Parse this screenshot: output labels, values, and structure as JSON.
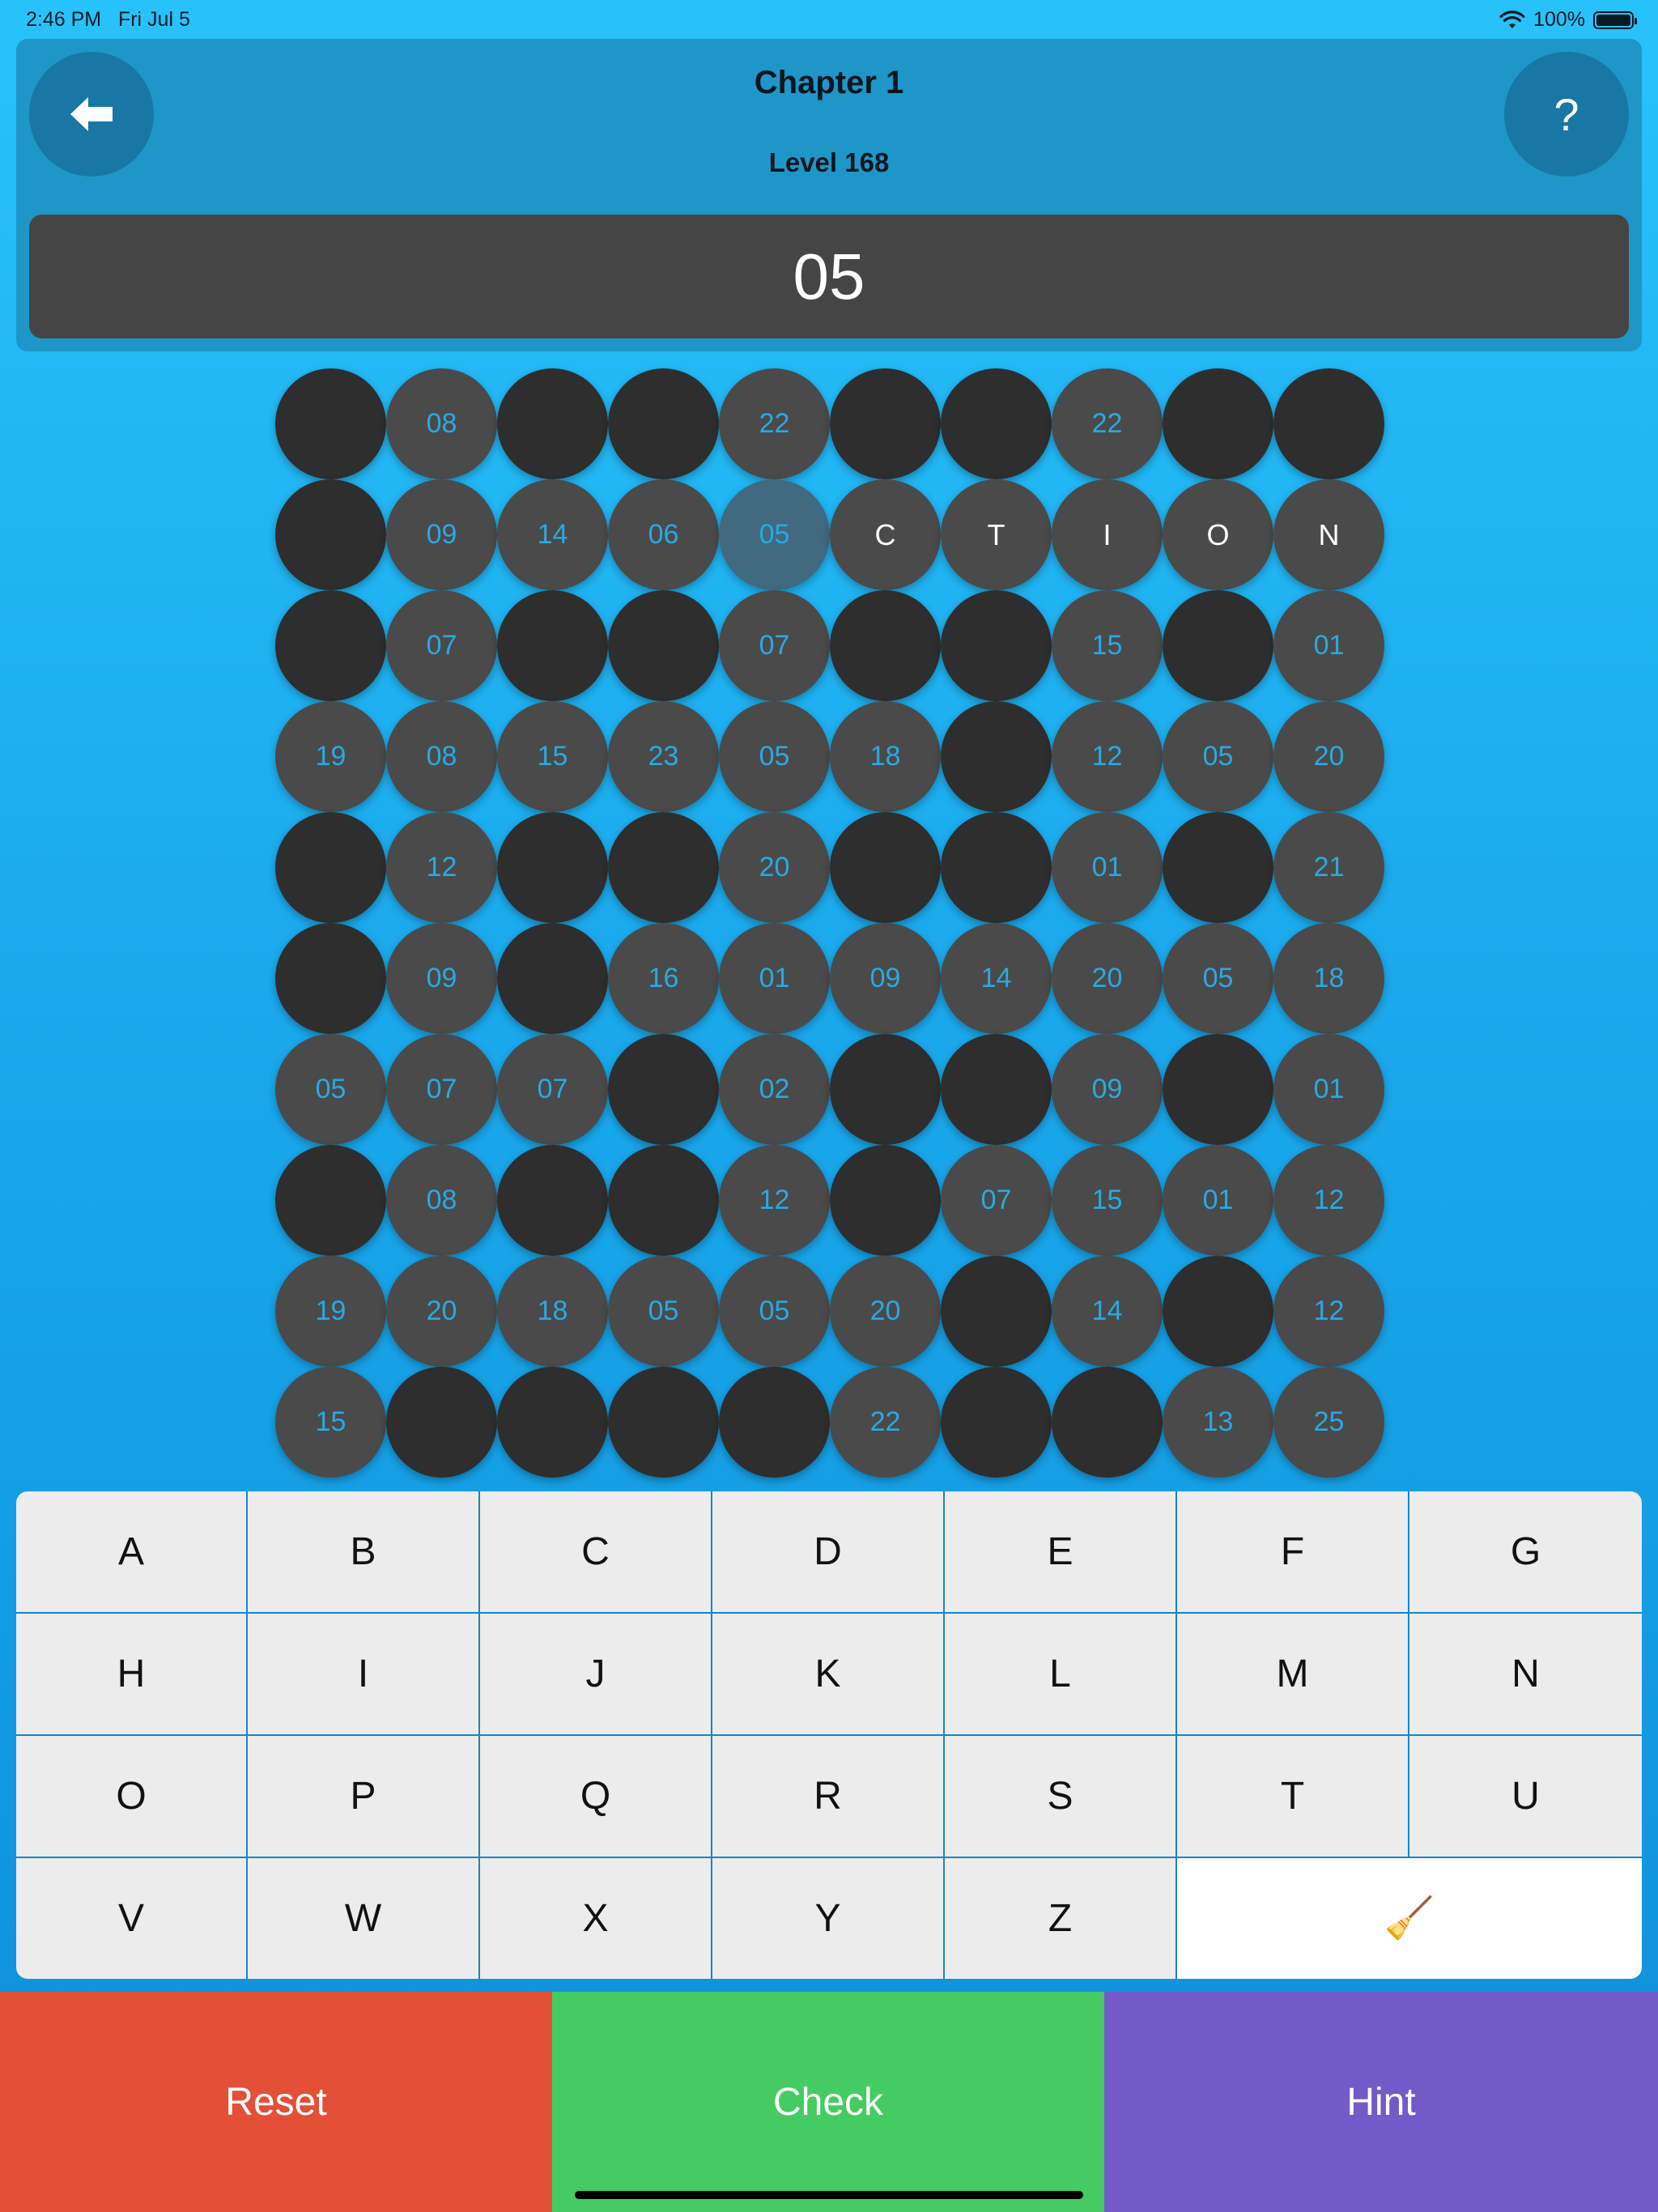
{
  "status_bar": {
    "time": "2:46 PM",
    "date": "Fri Jul 5",
    "battery": "100%"
  },
  "header": {
    "chapter": "Chapter 1",
    "level": "Level 168",
    "help_label": "?",
    "clue": "05"
  },
  "grid": {
    "rows": [
      [
        "",
        "08",
        "",
        "",
        "22",
        "",
        "",
        "22",
        "",
        ""
      ],
      [
        "",
        "09",
        "14",
        "06",
        "05",
        "C",
        "T",
        "I",
        "O",
        "N"
      ],
      [
        "",
        "07",
        "",
        "",
        "07",
        "",
        "",
        "15",
        "",
        "01"
      ],
      [
        "19",
        "08",
        "15",
        "23",
        "05",
        "18",
        "",
        "12",
        "05",
        "20"
      ],
      [
        "",
        "12",
        "",
        "",
        "20",
        "",
        "",
        "01",
        "",
        "21"
      ],
      [
        "",
        "09",
        "",
        "16",
        "01",
        "09",
        "14",
        "20",
        "05",
        "18"
      ],
      [
        "05",
        "07",
        "07",
        "",
        "02",
        "",
        "",
        "09",
        "",
        "01"
      ],
      [
        "",
        "08",
        "",
        "",
        "12",
        "",
        "07",
        "15",
        "01",
        "12"
      ],
      [
        "19",
        "20",
        "18",
        "05",
        "05",
        "20",
        "",
        "14",
        "",
        "12"
      ],
      [
        "15",
        "",
        "",
        "",
        "",
        "22",
        "",
        "",
        "13",
        "25"
      ]
    ],
    "selected_cell": [
      1,
      4
    ]
  },
  "keyboard": {
    "keys": [
      "A",
      "B",
      "C",
      "D",
      "E",
      "F",
      "G",
      "H",
      "I",
      "J",
      "K",
      "L",
      "M",
      "N",
      "O",
      "P",
      "Q",
      "R",
      "S",
      "T",
      "U",
      "V",
      "W",
      "X",
      "Y",
      "Z"
    ],
    "clear_icon": "broom-icon",
    "clear_glyph": "🧹"
  },
  "actions": {
    "reset": "Reset",
    "check": "Check",
    "hint": "Hint"
  },
  "colors": {
    "reset": "#e34f37",
    "check": "#44cc62",
    "hint": "#7459c9",
    "cell_number_text": "#2aa9e0",
    "cell_blocked": "#2e2e2e",
    "cell_open": "#4a4a4a"
  }
}
